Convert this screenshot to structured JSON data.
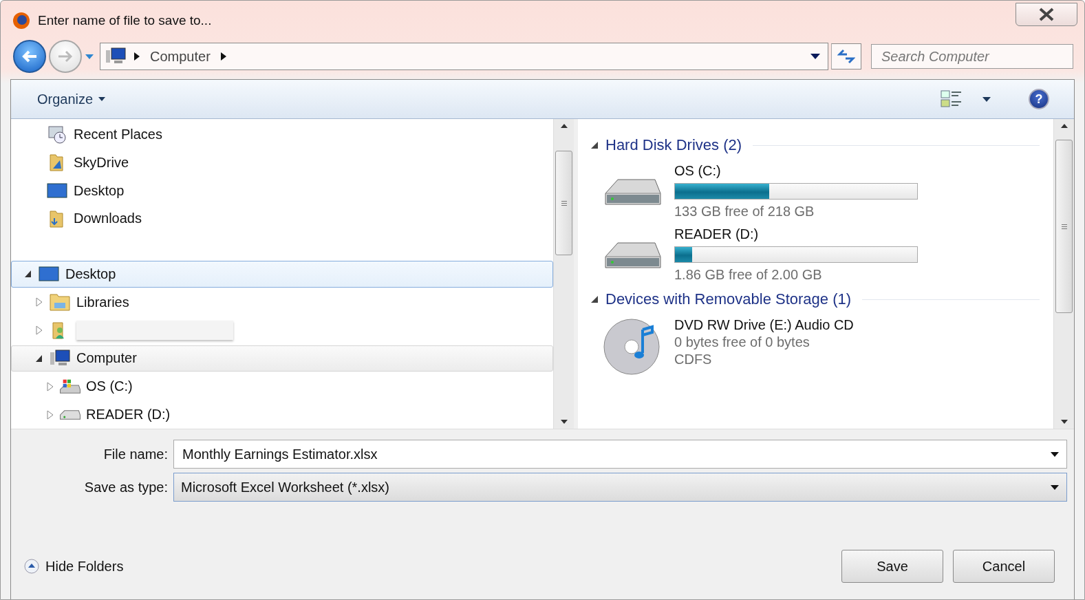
{
  "window": {
    "title": "Enter name of file to save to..."
  },
  "address_bar": {
    "path": [
      {
        "label": "Computer"
      }
    ]
  },
  "search": {
    "placeholder": "Search Computer"
  },
  "toolbar": {
    "organize": "Organize",
    "help": "?"
  },
  "favorites": [
    {
      "label": "Recent Places",
      "kind": "recent"
    },
    {
      "label": "SkyDrive",
      "kind": "cloud-folder"
    },
    {
      "label": "Desktop",
      "kind": "desktop"
    },
    {
      "label": "Downloads",
      "kind": "folder"
    }
  ],
  "tree": [
    {
      "label": "Desktop",
      "kind": "desktop",
      "expanded": true,
      "selected": true,
      "hovered": false,
      "children": [
        {
          "label": "Libraries",
          "kind": "libraries",
          "expanded": false,
          "selected": false,
          "hovered": false
        },
        {
          "kind": "redacted",
          "expanded": false,
          "selected": false,
          "hovered": false
        },
        {
          "label": "Computer",
          "kind": "computer",
          "expanded": true,
          "selected": false,
          "hovered": true,
          "children": [
            {
              "label": "OS (C:)",
              "kind": "os-drive",
              "expanded": false,
              "selected": false,
              "hovered": false
            },
            {
              "label": "READER (D:)",
              "kind": "drive",
              "expanded": false,
              "selected": false,
              "hovered": false
            }
          ]
        }
      ]
    }
  ],
  "groups": [
    {
      "title": "Hard Disk Drives (2)",
      "expanded": true,
      "items": [
        {
          "kind": "disk",
          "name": "OS (C:)",
          "level": 0.39,
          "details": [
            "133 GB free of 218 GB"
          ]
        },
        {
          "kind": "disk",
          "name": "READER (D:)",
          "level": 0.07,
          "details": [
            "1.86 GB free of 2.00 GB"
          ]
        }
      ]
    },
    {
      "title": "Devices with Removable Storage (1)",
      "expanded": true,
      "items": [
        {
          "kind": "optical",
          "name": "DVD RW Drive (E:) Audio CD",
          "details": [
            "0 bytes free of 0 bytes",
            "CDFS"
          ]
        }
      ]
    }
  ],
  "form": {
    "fields": [
      {
        "label": "File name:",
        "value": "Monthly Earnings Estimator.xlsx",
        "kind": "editable"
      },
      {
        "label": "Save as type:",
        "value": "Microsoft Excel Worksheet (*.xlsx)",
        "kind": "list"
      }
    ]
  },
  "hide_folders": {
    "label": "Hide Folders"
  },
  "buttons": [
    "Save",
    "Cancel"
  ]
}
